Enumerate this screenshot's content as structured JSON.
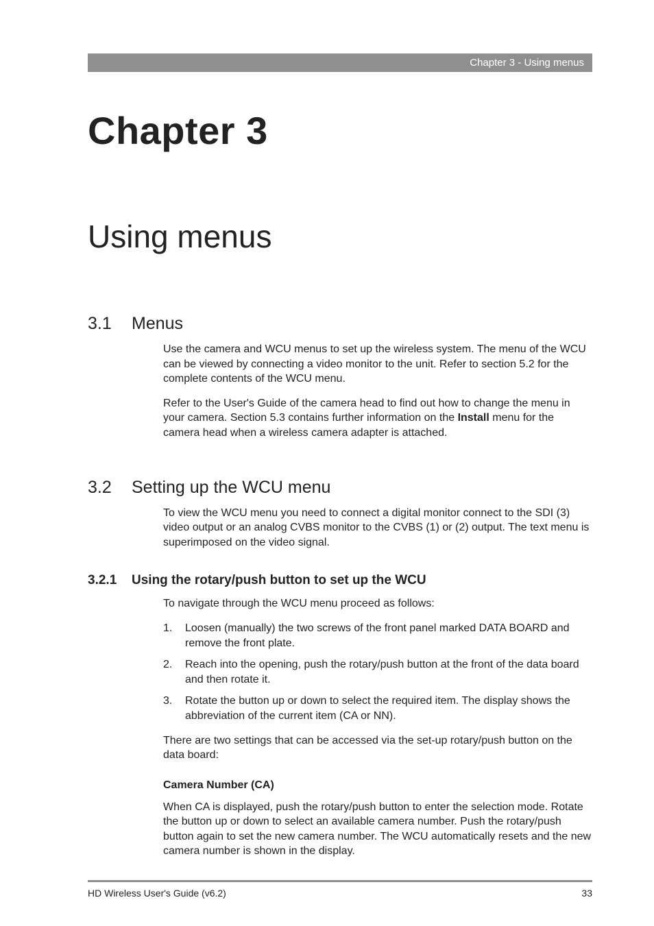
{
  "header": {
    "text": "Chapter 3 - Using menus"
  },
  "chapter": {
    "title": "Chapter 3",
    "subtitle": "Using menus"
  },
  "sections": {
    "s31": {
      "num": "3.1",
      "title": "Menus",
      "p1": "Use the camera and WCU menus to set up the wireless system. The menu of the WCU can be viewed by connecting a video monitor to the unit. Refer to section 5.2 for the complete contents of the WCU menu.",
      "p2a": "Refer to the User's Guide of the camera head to find out how to change the menu in your camera. Section 5.3 contains further information on the ",
      "p2b_bold": "Install",
      "p2c": " menu for the camera head when a wireless camera adapter is attached."
    },
    "s32": {
      "num": "3.2",
      "title": "Setting up the WCU menu",
      "p1": "To view the WCU menu you need to connect a digital monitor connect to the SDI (3) video output or an analog CVBS monitor to the CVBS (1) or (2) output. The text menu is superimposed on the video signal."
    },
    "s321": {
      "num": "3.2.1",
      "title": "Using the rotary/push button to set up the WCU",
      "intro": "To navigate through the WCU menu proceed as follows:",
      "steps": [
        {
          "n": "1.",
          "t": "Loosen (manually) the two screws of the front panel marked DATA BOARD and remove the front plate."
        },
        {
          "n": "2.",
          "t": "Reach into the opening, push the rotary/push button at the front of the data board and then rotate it."
        },
        {
          "n": "3.",
          "t": "Rotate the button up or down to select the required item. The display shows the abbreviation of the current item (CA or NN)."
        }
      ],
      "after": "There are two settings that can be accessed via the set-up rotary/push button on the data board:",
      "run_in_heading": "Camera Number (CA)",
      "run_in_body": "When CA is displayed, push the rotary/push button to enter the selection mode. Rotate the button up or down to select an available camera number. Push the rotary/push button again to set the new camera number. The WCU automatically resets and the new camera number is shown in the display."
    }
  },
  "footer": {
    "left": "HD Wireless User's Guide (v6.2)",
    "right": "33"
  }
}
